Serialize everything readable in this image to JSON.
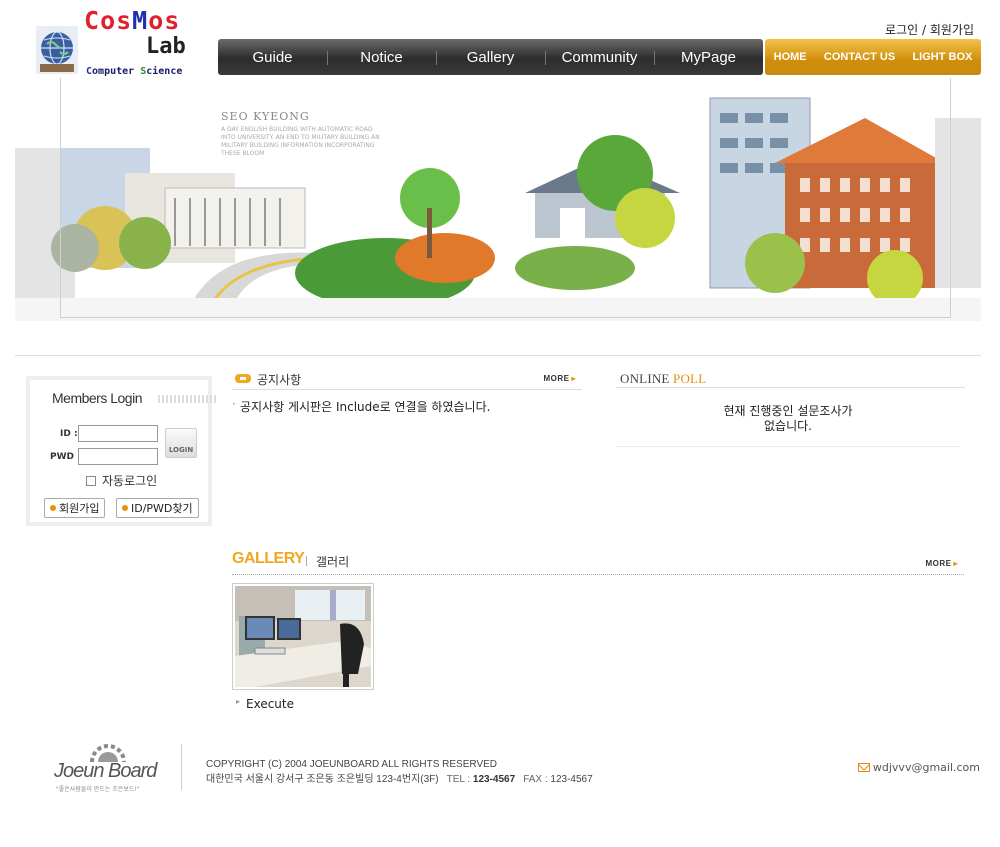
{
  "logo": {
    "line1_c": "C",
    "line1_os": "os",
    "line1_m": "M",
    "line1_rest": "os",
    "line2": "Lab",
    "line3_c": "C",
    "line3_mid": "omputer ",
    "line3_s": "S",
    "line3_rest": "cience"
  },
  "top_links": {
    "login": "로그인",
    "separator": " / ",
    "signup": "회원가입"
  },
  "main_nav": [
    "Guide",
    "Notice",
    "Gallery",
    "Community",
    "MyPage"
  ],
  "sub_nav": [
    "HOME",
    "CONTACT US",
    "LIGHT BOX"
  ],
  "banner": {
    "university": "SEO KYEONG",
    "university_sub": "UNIVERSITY",
    "caption": "A DAY ENGLISH BUILDING WITH AUTOMATIC ROAD INTO UNIVERSITY. AN END TO MILITARY BUILDING AN MILITARY BUILDING INFORMATION INCORPORATING THESE BLOOM"
  },
  "login": {
    "title": "Members Login",
    "id_label": "ID :",
    "pwd_label": "PWD :",
    "login_button": "LOGIN",
    "auto_login": "자동로그인",
    "signup_button": "회원가입",
    "find_button": "ID/PWD찾기"
  },
  "notice": {
    "title": "공지사항",
    "more": "MORE",
    "items": [
      "공지사항 게시판은 Include로 연결을 하였습니다."
    ]
  },
  "poll": {
    "title_a": "ONLINE ",
    "title_b": "POLL",
    "line1": "현재 진행중인 설문조사가",
    "line2": "없습니다."
  },
  "gallery": {
    "title_en": "GALLERY",
    "title_ko": "갤러리",
    "more": "MORE",
    "items": [
      {
        "caption": "Execute"
      }
    ]
  },
  "footer": {
    "brand": "Joeun Board",
    "slogan": "\"좋은사람들이 만드는 조은보드!\"",
    "copyright": "COPYRIGHT (C) 2004 JOEUNBOARD ALL RIGHTS RESERVED",
    "address": "대한민국 서울시 강서구 조은동 조은빌딩 123-4번지(3F)",
    "tel_label": "TEL :",
    "tel": "123-4567",
    "fax_label": "FAX : ",
    "fax": "123-4567",
    "email": "wdjvvv@gmail.com"
  },
  "colors": {
    "accent": "#f0a820",
    "nav_dark": "#2c2c2c",
    "logo_red": "#e0202a",
    "logo_blue": "#2030b0",
    "logo_green": "#2a8a2a"
  },
  "icons": {
    "globe": "globe-icon",
    "envelope": "envelope-icon",
    "notice": "notice-icon"
  }
}
